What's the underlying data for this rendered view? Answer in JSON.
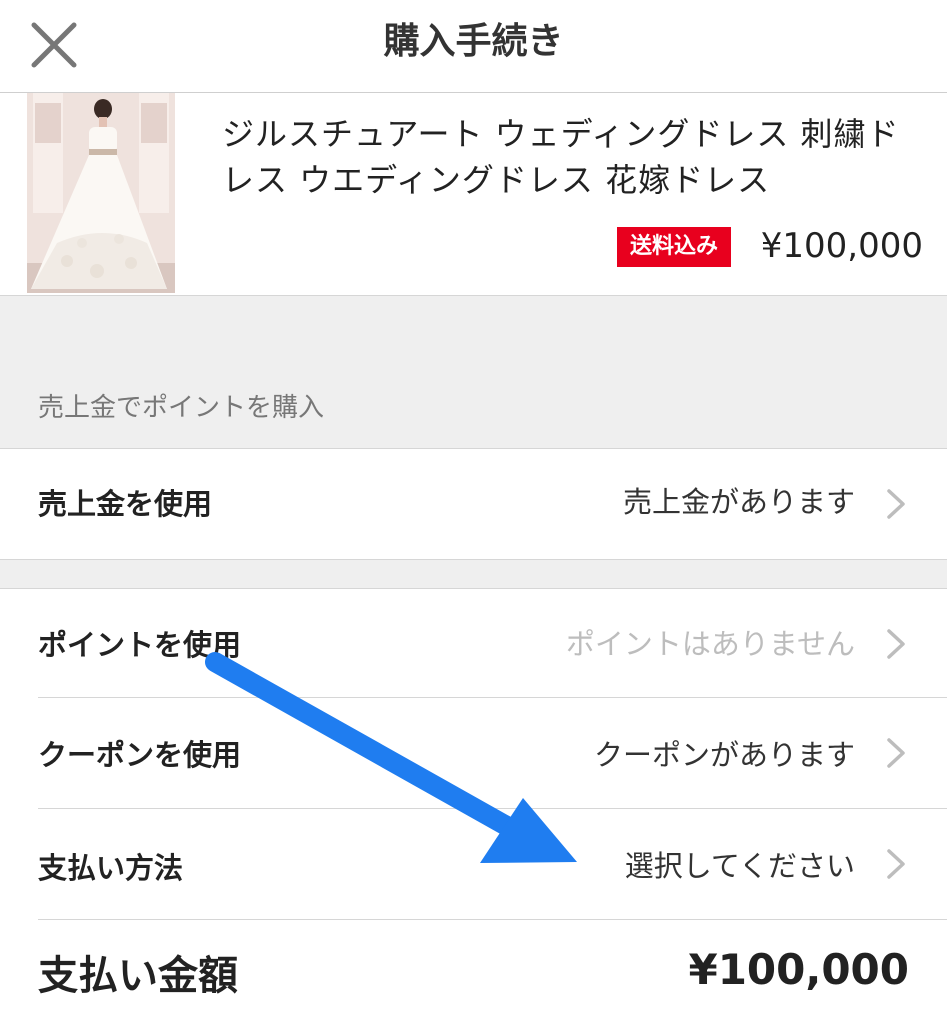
{
  "header": {
    "title": "購入手続き",
    "close_icon": "close-x-icon"
  },
  "product": {
    "name": "ジルスチュアート ウェディングドレス 刺繍ドレス ウエディングドレス 花嫁ドレス",
    "badge": "送料込み",
    "price": "¥100,000",
    "badge_color": "#e8001e"
  },
  "sales_section": {
    "label": "売上金でポイントを購入"
  },
  "rows": {
    "sales": {
      "label": "売上金を使用",
      "value": "売上金があります"
    },
    "points": {
      "label": "ポイントを使用",
      "value": "ポイントはありません"
    },
    "coupon": {
      "label": "クーポンを使用",
      "value": "クーポンがあります"
    },
    "payment": {
      "label": "支払い方法",
      "value": "選択してください"
    }
  },
  "total": {
    "label": "支払い金額",
    "value": "¥100,000"
  },
  "annotation": {
    "arrow_color": "#1f7df0",
    "icon": "blue-arrow-icon"
  }
}
